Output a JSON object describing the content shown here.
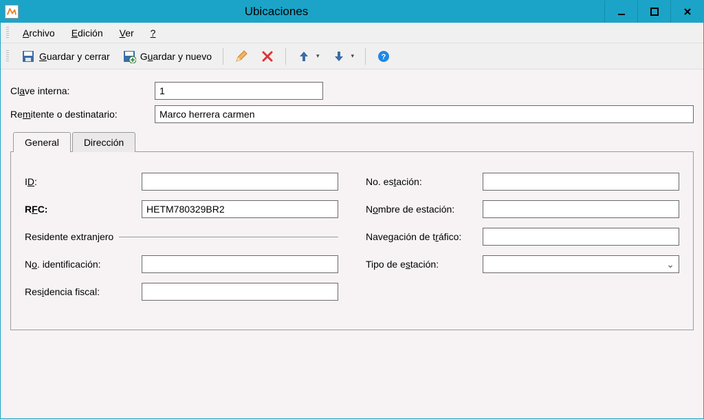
{
  "window": {
    "title": "Ubicaciones"
  },
  "menu": {
    "archivo": "Archivo",
    "edicion": "Edición",
    "ver": "Ver",
    "help": "?"
  },
  "toolbar": {
    "save_close": "Guardar y cerrar",
    "save_new": "Guardar y nuevo"
  },
  "header": {
    "clave_label": "Clave interna:",
    "clave_value": "1",
    "remitente_label": "Remitente o destinatario:",
    "remitente_value": "Marco herrera carmen"
  },
  "tabs": {
    "general": "General",
    "direccion": "Dirección"
  },
  "general": {
    "left": {
      "id_label": "ID:",
      "id_value": "",
      "rfc_label": "RFC:",
      "rfc_value": "HETM780329BR2",
      "residente_section": "Residente extranjero",
      "no_ident_label": "No. identificación:",
      "no_ident_value": "",
      "residencia_label": "Residencia fiscal:",
      "residencia_value": ""
    },
    "right": {
      "no_estacion_label": "No. estación:",
      "no_estacion_value": "",
      "nombre_estacion_label": "Nombre de estación:",
      "nombre_estacion_value": "",
      "nav_trafico_label": "Navegación de tráfico:",
      "nav_trafico_value": "",
      "tipo_estacion_label": "Tipo de estación:",
      "tipo_estacion_value": ""
    }
  }
}
